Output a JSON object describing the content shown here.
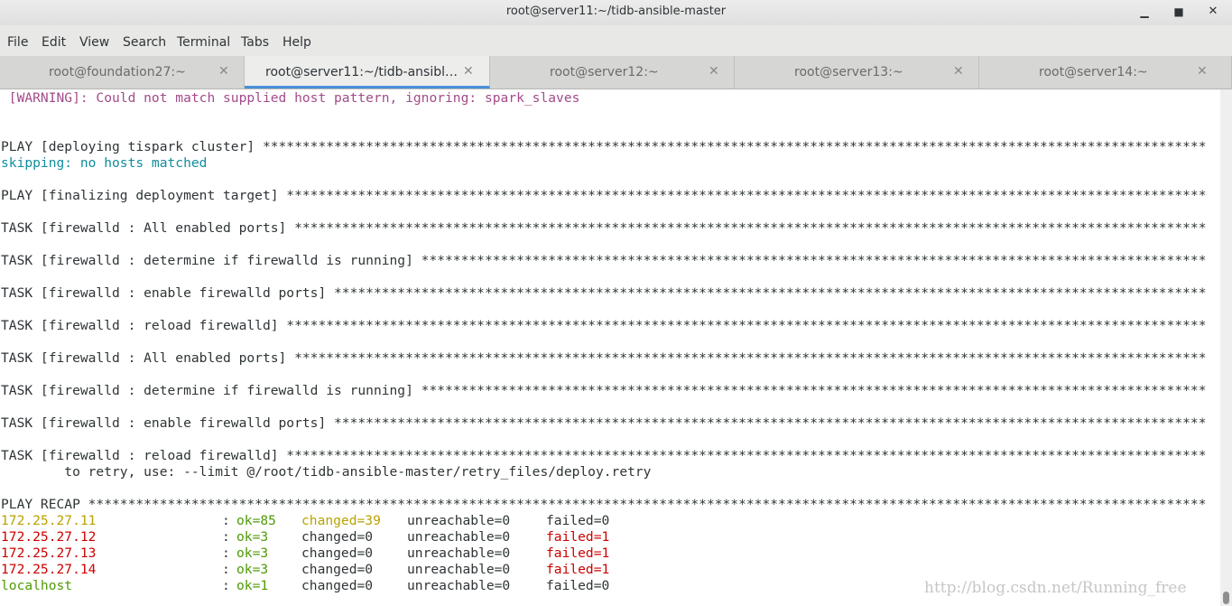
{
  "window": {
    "title": "root@server11:~/tidb-ansible-master",
    "minimize_icon": "minimize-icon",
    "maximize_icon": "maximize-icon",
    "close_icon": "close-icon"
  },
  "menu": [
    "File",
    "Edit",
    "View",
    "Search",
    "Terminal",
    "Tabs",
    "Help"
  ],
  "tabs": [
    {
      "label": "root@foundation27:~",
      "close": "✕"
    },
    {
      "label": "root@server11:~/tidb-ansibl…",
      "close": "✕"
    },
    {
      "label": "root@server12:~",
      "close": "✕"
    },
    {
      "label": "root@server13:~",
      "close": "✕"
    },
    {
      "label": "root@server14:~",
      "close": "✕"
    }
  ],
  "terminal": {
    "warning": " [WARNING]: Could not match supplied host pattern, ignoring: spark_slaves",
    "play1": "PLAY [deploying tispark cluster] ***********************************************************************************************************************",
    "skipping": "skipping: no hosts matched",
    "play2": "PLAY [finalizing deployment target] ********************************************************************************************************************",
    "task1": "TASK [firewalld : All enabled ports] *******************************************************************************************************************",
    "task2": "TASK [firewalld : determine if firewalld is running] ***************************************************************************************************",
    "task3": "TASK [firewalld : enable firewalld ports] **************************************************************************************************************",
    "task4": "TASK [firewalld : reload firewalld] ********************************************************************************************************************",
    "task5": "TASK [firewalld : All enabled ports] *******************************************************************************************************************",
    "task6": "TASK [firewalld : determine if firewalld is running] ***************************************************************************************************",
    "task7": "TASK [firewalld : enable firewalld ports] **************************************************************************************************************",
    "task8": "TASK [firewalld : reload firewalld] ********************************************************************************************************************",
    "retry": "        to retry, use: --limit @/root/tidb-ansible-master/retry_files/deploy.retry",
    "recap": "PLAY RECAP *********************************************************************************************************************************************",
    "hosts": [
      {
        "host": "172.25.27.11",
        "colon": ":",
        "ok": "ok=85",
        "changed": "changed=39",
        "unreachable": "unreachable=0",
        "failed": "failed=0"
      },
      {
        "host": "172.25.27.12",
        "colon": ":",
        "ok": "ok=3",
        "changed": "changed=0",
        "unreachable": "unreachable=0",
        "failed": "failed=1"
      },
      {
        "host": "172.25.27.13",
        "colon": ":",
        "ok": "ok=3",
        "changed": "changed=0",
        "unreachable": "unreachable=0",
        "failed": "failed=1"
      },
      {
        "host": "172.25.27.14",
        "colon": ":",
        "ok": "ok=3",
        "changed": "changed=0",
        "unreachable": "unreachable=0",
        "failed": "failed=1"
      },
      {
        "host": "localhost",
        "colon": ":",
        "ok": "ok=1",
        "changed": "changed=0",
        "unreachable": "unreachable=0",
        "failed": "failed=0"
      }
    ]
  },
  "watermark": "http://blog.csdn.net/Running_free",
  "colors": {
    "warning": "#a34b8a",
    "skipping": "#0f8d9c",
    "changed": "#b8a200",
    "ok": "#4e9a06",
    "failed": "#cc0000",
    "active_tab_accent": "#4a90d9"
  }
}
